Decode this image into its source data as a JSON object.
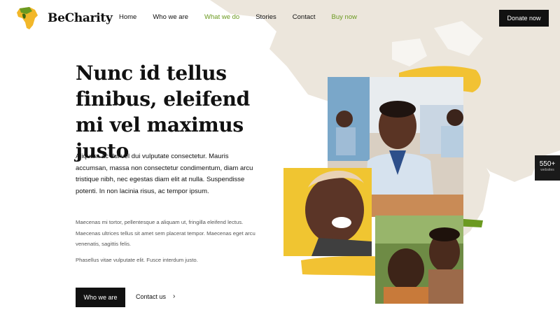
{
  "brand": {
    "name": "BeCharity",
    "logo_icon": "africa-map-icon"
  },
  "nav": {
    "items": [
      {
        "label": "Home",
        "active": false
      },
      {
        "label": "Who we are",
        "active": false
      },
      {
        "label": "What we do",
        "active": true
      },
      {
        "label": "Stories",
        "active": false
      },
      {
        "label": "Contact",
        "active": false
      },
      {
        "label": "Buy now",
        "active": false,
        "accent": true
      }
    ],
    "donate_label": "Donate now"
  },
  "hero": {
    "title": "Nunc id tellus finibus, eleifend mi vel maximus justo",
    "lead": "Aliquam ac dui vel dui vulputate consectetur. Mauris accumsan, massa non consectetur condimentum, diam arcu tristique nibh, nec egestas diam elit at nulla. Suspendisse potenti. In non lacinia risus, ac tempor ipsum.",
    "body": "Maecenas mi tortor, pellentesque a aliquam ut, fringilla eleifend lectus. Maecenas ultrices tellus sit amet sem placerat tempor. Maecenas eget arcu venenatis, sagittis felis.",
    "body2": "Phasellus vitae vulputate elit. Fusce interdum justo.",
    "primary_button": "Who we are",
    "secondary_link": "Contact us"
  },
  "side_badge": {
    "count": "550+",
    "label": "websites"
  },
  "colors": {
    "accent_green": "#6b9a20",
    "accent_yellow": "#f2c233",
    "map_beige": "#ece6dc",
    "dark": "#111111"
  }
}
